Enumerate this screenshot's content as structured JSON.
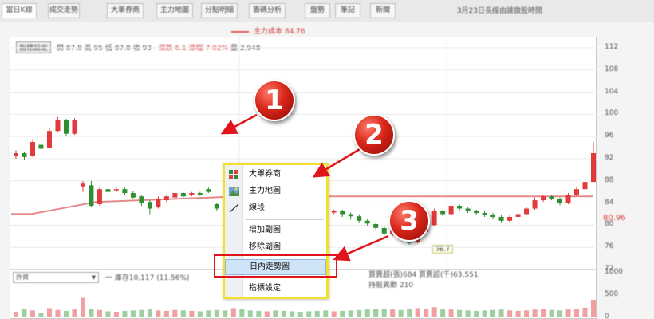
{
  "tabs": [
    {
      "label": "當日K線"
    },
    {
      "label": "成交走勢"
    },
    {
      "label": "大單券商"
    },
    {
      "label": "主力地圖"
    },
    {
      "label": "分點明細"
    },
    {
      "label": "籌碼分析"
    },
    {
      "label": "盤勢"
    },
    {
      "label": "筆記"
    },
    {
      "label": "新聞"
    }
  ],
  "header_right": "3月23日長線由誰做股時間",
  "legend": "主力成本 84.76",
  "info_bar": {
    "button": "指標設定",
    "open": "開 87.8",
    "high": "高 95",
    "low": "低 87.8",
    "close": "收 93",
    "change": "漲跌 6.1",
    "pct_label": "漲幅",
    "pct": "7.02%",
    "volume": "量 2,948"
  },
  "price_axis": [
    "112",
    "108",
    "104",
    "100",
    "96",
    "92",
    "88",
    "84",
    "80",
    "76",
    "72"
  ],
  "current_price": "80.96",
  "low_label": "76.7",
  "lower_panel": {
    "select": "外資",
    "info": "一 庫存10,117 (11.56%)",
    "info2_line1": "買賣超(張)684 買賣超(千)63,551",
    "info2_line2": "持股異動 210",
    "ticks": [
      "1000",
      "500",
      "0"
    ]
  },
  "context_menu": {
    "items": [
      {
        "label": "大單券商",
        "icon": "broker-icon"
      },
      {
        "label": "主力地圖",
        "icon": "map-icon"
      },
      {
        "label": "線段",
        "icon": "line-icon"
      },
      {
        "label": "增加副圖"
      },
      {
        "label": "移除副圖"
      },
      {
        "label": "日內走勢圖",
        "highlighted": true
      },
      {
        "label": "指標設定"
      }
    ]
  },
  "markers": [
    "1",
    "2",
    "3"
  ],
  "colors": {
    "up": "#e03a3a",
    "down": "#2f8f2f",
    "cost_line": "#e58a8a",
    "annotation": "#e0141b",
    "menu_border": "#f2e02a",
    "menu_highlight": "#cfe4f7"
  },
  "chart_data": {
    "type": "candlestick",
    "ylim": [
      72,
      114
    ],
    "cost_line": 84.76,
    "candles": [
      [
        92.5,
        93.0,
        93.5,
        92.0
      ],
      [
        93.0,
        92.3,
        93.2,
        91.8
      ],
      [
        92.5,
        95.0,
        95.5,
        92.3
      ],
      [
        94.5,
        93.8,
        95.0,
        93.5
      ],
      [
        94.0,
        97.0,
        97.5,
        93.8
      ],
      [
        97.0,
        99.0,
        99.5,
        96.8
      ],
      [
        99.0,
        96.5,
        99.2,
        96.0
      ],
      [
        96.5,
        99.0,
        99.3,
        96.3
      ],
      [
        87.0,
        87.5,
        88.0,
        86.0
      ],
      [
        87.2,
        83.5,
        88.0,
        83.2
      ],
      [
        83.8,
        86.5,
        87.0,
        83.5
      ],
      [
        86.5,
        86.0,
        86.8,
        85.5
      ],
      [
        86.3,
        86.5,
        86.8,
        86.0
      ],
      [
        86.5,
        85.8,
        86.8,
        85.5
      ],
      [
        85.8,
        85.0,
        86.2,
        84.8
      ],
      [
        85.2,
        84.0,
        85.5,
        83.5
      ],
      [
        84.2,
        83.0,
        84.5,
        82.0
      ],
      [
        83.2,
        84.8,
        85.2,
        83.0
      ],
      [
        84.5,
        85.2,
        85.5,
        84.2
      ],
      [
        85.0,
        85.8,
        86.2,
        84.8
      ],
      [
        85.8,
        85.2,
        86.0,
        85.0
      ],
      [
        85.5,
        85.8,
        86.0,
        85.2
      ],
      [
        85.8,
        85.5,
        86.0,
        85.3
      ],
      [
        86.5,
        86.0,
        86.8,
        85.8
      ],
      [
        83.8,
        83.0,
        84.0,
        82.5
      ],
      [
        84.0,
        83.5,
        84.8,
        83.2
      ],
      [
        86.0,
        88.5,
        89.0,
        85.8
      ],
      [
        88.0,
        86.0,
        88.2,
        85.8
      ],
      [
        85.8,
        85.2,
        86.0,
        85.0
      ],
      [
        85.3,
        84.5,
        85.5,
        84.3
      ],
      [
        84.5,
        85.5,
        86.0,
        84.3
      ],
      [
        85.6,
        84.2,
        85.8,
        84.0
      ],
      [
        84.3,
        84.0,
        84.6,
        83.5
      ],
      [
        84.0,
        83.5,
        84.3,
        83.2
      ],
      [
        83.6,
        83.2,
        84.0,
        82.8
      ],
      [
        83.3,
        83.0,
        83.6,
        82.6
      ],
      [
        83.0,
        82.7,
        83.3,
        82.3
      ],
      [
        82.6,
        82.3,
        83.0,
        82.0
      ],
      [
        82.3,
        82.5,
        82.8,
        82.0
      ],
      [
        82.5,
        82.0,
        82.8,
        81.5
      ],
      [
        82.0,
        81.6,
        82.3,
        81.0
      ],
      [
        81.6,
        80.8,
        82.0,
        80.5
      ],
      [
        80.8,
        80.3,
        81.2,
        79.8
      ],
      [
        80.2,
        79.5,
        80.6,
        79.0
      ],
      [
        79.5,
        78.5,
        80.0,
        78.0
      ],
      [
        78.3,
        79.5,
        80.0,
        78.0
      ],
      [
        79.0,
        78.0,
        79.3,
        77.5
      ],
      [
        78.0,
        76.8,
        78.3,
        76.5
      ],
      [
        77.0,
        78.8,
        79.2,
        76.7
      ],
      [
        78.8,
        80.0,
        80.5,
        78.5
      ],
      [
        80.0,
        82.5,
        83.0,
        79.8
      ],
      [
        82.5,
        82.0,
        82.8,
        81.6
      ],
      [
        82.0,
        83.5,
        84.0,
        81.8
      ],
      [
        83.5,
        83.0,
        83.8,
        82.6
      ],
      [
        83.0,
        82.5,
        83.3,
        82.2
      ],
      [
        82.5,
        82.2,
        82.8,
        81.8
      ],
      [
        82.2,
        81.8,
        82.5,
        81.5
      ],
      [
        81.8,
        81.5,
        82.2,
        81.2
      ],
      [
        81.5,
        80.8,
        81.8,
        80.5
      ],
      [
        80.8,
        81.5,
        81.8,
        80.5
      ],
      [
        81.5,
        82.0,
        82.3,
        81.2
      ],
      [
        82.0,
        83.0,
        83.3,
        81.8
      ],
      [
        83.0,
        84.5,
        85.0,
        82.8
      ],
      [
        84.5,
        85.2,
        85.5,
        84.2
      ],
      [
        85.2,
        84.8,
        85.5,
        84.5
      ],
      [
        84.8,
        84.0,
        85.0,
        83.6
      ],
      [
        84.0,
        85.5,
        85.8,
        83.8
      ],
      [
        85.5,
        86.5,
        87.0,
        85.2
      ],
      [
        86.5,
        87.8,
        88.2,
        86.2
      ],
      [
        87.8,
        93.0,
        95.0,
        87.8
      ]
    ],
    "volumes": [
      120,
      180,
      150,
      90,
      200,
      160,
      140,
      170,
      420,
      180,
      160,
      130,
      120,
      140,
      150,
      160,
      170,
      150,
      140,
      160,
      150,
      140,
      130,
      150,
      160,
      150,
      200,
      180,
      150,
      140,
      130,
      150,
      140,
      130,
      120,
      130,
      140,
      150,
      130,
      140,
      150,
      160,
      170,
      180,
      190,
      170,
      160,
      180,
      200,
      190,
      220,
      180,
      170,
      160,
      150,
      140,
      150,
      160,
      170,
      150,
      140,
      150,
      170,
      180,
      160,
      150,
      170,
      190,
      210,
      380
    ]
  }
}
